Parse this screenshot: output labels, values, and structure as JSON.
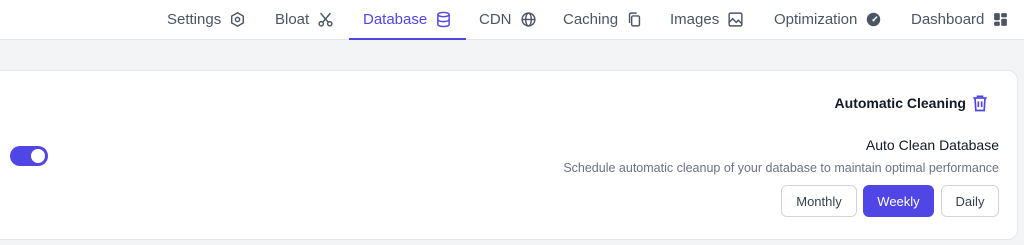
{
  "nav": {
    "tabs": [
      {
        "label": "Settings",
        "icon": "settings-icon"
      },
      {
        "label": "Bloat",
        "icon": "scissors-icon"
      },
      {
        "label": "Database",
        "icon": "database-icon",
        "active": true
      },
      {
        "label": "CDN",
        "icon": "globe-icon"
      },
      {
        "label": "Caching",
        "icon": "copy-icon"
      },
      {
        "label": "Images",
        "icon": "image-icon"
      },
      {
        "label": "Optimization",
        "icon": "gauge-icon"
      },
      {
        "label": "Dashboard",
        "icon": "dashboard-grid-icon"
      }
    ]
  },
  "section": {
    "title": "Automatic Cleaning",
    "title_icon": "trash-icon"
  },
  "setting": {
    "title": "Auto Clean Database",
    "description": "Schedule automatic cleanup of your database to maintain optimal performance",
    "enabled": true,
    "frequency_options": [
      "Monthly",
      "Weekly",
      "Daily"
    ],
    "selected_frequency": "Weekly"
  },
  "colors": {
    "accent": "#4f46e5",
    "background": "#f3f4f6",
    "card": "#ffffff"
  }
}
